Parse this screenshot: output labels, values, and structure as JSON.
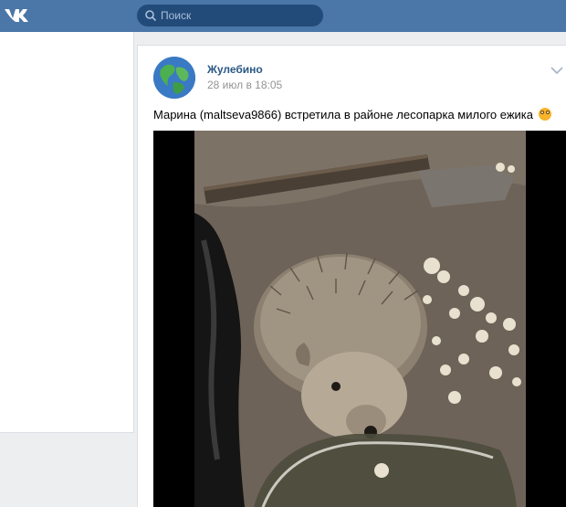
{
  "app": {
    "brand": "VK",
    "accent": "#4a76a8"
  },
  "search": {
    "placeholder": "Поиск"
  },
  "post": {
    "author": "Жулебино",
    "date": "28 июл в 18:05",
    "text": "Марина (maltseva9866) встретила в районе лесопарка милого ежика",
    "emoji": "grinning-face-emoji",
    "media": "video-hedgehog-photo"
  },
  "icons": {
    "logo": "vk-logo-icon",
    "search": "search-icon",
    "menu": "chevron-down-icon"
  }
}
